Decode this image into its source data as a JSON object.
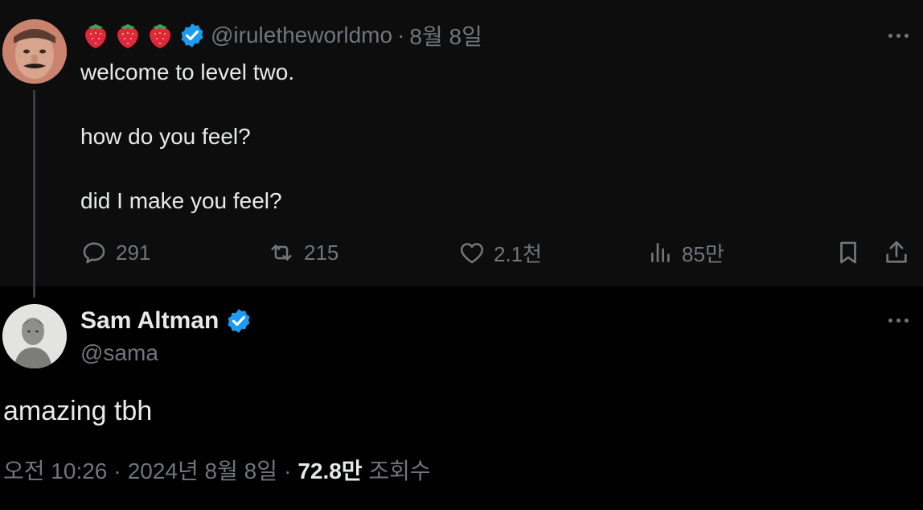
{
  "parent_tweet": {
    "emojis": [
      "strawberry-emoji",
      "strawberry-emoji",
      "strawberry-emoji"
    ],
    "handle": "@iruletheworldmo",
    "separator": "·",
    "date": "8월 8일",
    "lines": [
      "welcome to level two.",
      "",
      "how do you feel?",
      "",
      "did I make you feel?"
    ],
    "stats": {
      "replies": "291",
      "reposts": "215",
      "likes": "2.1천",
      "views": "85만"
    },
    "verified_color": "#1d9bf0"
  },
  "reply_tweet": {
    "name": "Sam Altman",
    "handle": "@sama",
    "text": "amazing tbh",
    "time": "오전 10:26",
    "sep1": "·",
    "date": "2024년 8월 8일",
    "sep2": "·",
    "views": "72.8만",
    "views_label": "조회수"
  },
  "colors": {
    "background": "#000000",
    "parent_background": "#0d0d0d",
    "text": "#e7e9ea",
    "muted": "#71767b",
    "accent": "#1d9bf0"
  }
}
